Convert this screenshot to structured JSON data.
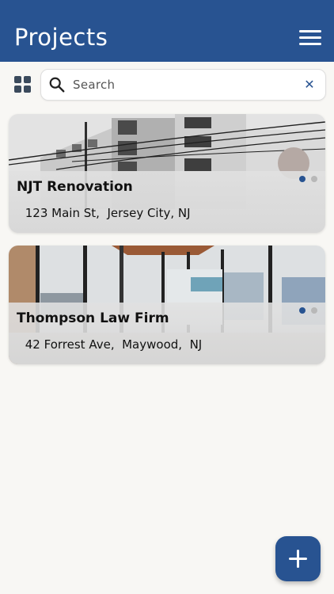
{
  "header": {
    "title": "Projects",
    "menu_icon": "hamburger-menu-icon",
    "background": "#285391"
  },
  "toolbar": {
    "view_toggle_icon": "grid-view-icon",
    "search": {
      "placeholder": "Search",
      "value": "",
      "clear_icon": "close-icon"
    }
  },
  "projects": [
    {
      "name": "NJT Renovation",
      "address": " 123 Main St,  Jersey City, NJ",
      "image": "building-exterior-photo",
      "carousel_page": 1,
      "carousel_total": 2
    },
    {
      "name": "Thompson Law Firm",
      "address": " 42 Forrest Ave,  Maywood,  NJ",
      "image": "office-interior-photo",
      "carousel_page": 1,
      "carousel_total": 2
    }
  ],
  "fab": {
    "icon": "plus-icon"
  },
  "colors": {
    "primary": "#285391",
    "page_background": "#f8f7f4",
    "dot_inactive": "#b8b8b8"
  }
}
